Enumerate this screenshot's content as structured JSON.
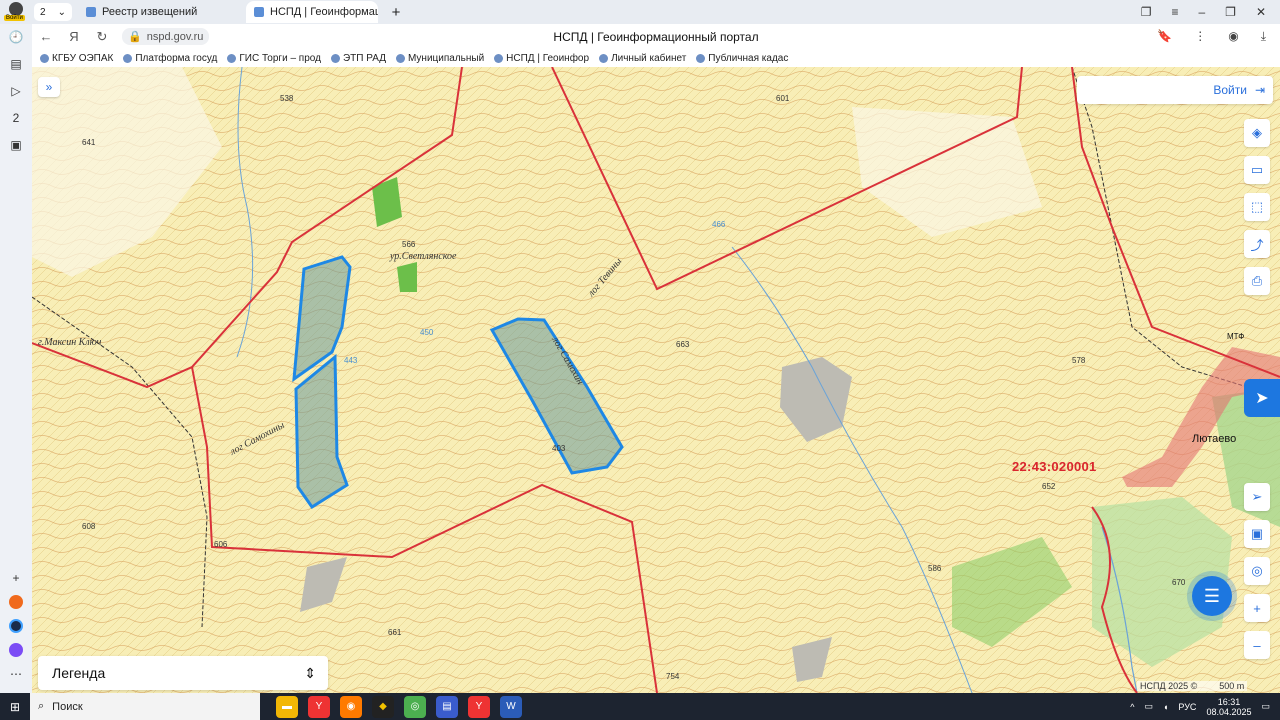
{
  "browser": {
    "profile_badge": "Войти",
    "tab_count": "2",
    "tabs": [
      {
        "label": "Реестр извещений"
      },
      {
        "label": "НСПД | Геоинформац"
      }
    ],
    "url": "nspd.gov.ru",
    "page_title": "НСПД | Геоинформационный портал",
    "bookmarks": [
      "КГБУ ОЭПАК",
      "Платформа госуд",
      "ГИС Торги – прод",
      "ЭТП РАД",
      "Муниципальный",
      "НСПД | Геоинфор",
      "Личный кабинет",
      "Публичная кадас"
    ],
    "sidebar_number": "2"
  },
  "map": {
    "login_label": "Войти",
    "legend_label": "Легенда",
    "cadastral_number": "22:43:020001",
    "copyright": "НСПД 2025 ©",
    "scale_label": "500 m",
    "place_labels": {
      "kluch": "г.Максин Ключ",
      "urochishe": "ур.Светлянское",
      "log1": "лог Самохины",
      "log2": "лог Самохин",
      "log3": "лог Тевины",
      "village": "Лютаево",
      "mtf": "МТФ"
    },
    "heights": [
      "538",
      "641",
      "566",
      "450",
      "443",
      "663",
      "601",
      "466",
      "578",
      "652",
      "608",
      "606",
      "661",
      "754",
      "586",
      "670",
      "403"
    ],
    "colors": {
      "boundary": "#d9323a",
      "parcel_stroke": "#1e88e5",
      "parcel_fill": "#6a9a9a",
      "accent": "#1d77e0"
    }
  },
  "taskbar": {
    "search_placeholder": "Поиск",
    "time": "16:31",
    "date": "08.04.2025",
    "lang": "РУС"
  }
}
